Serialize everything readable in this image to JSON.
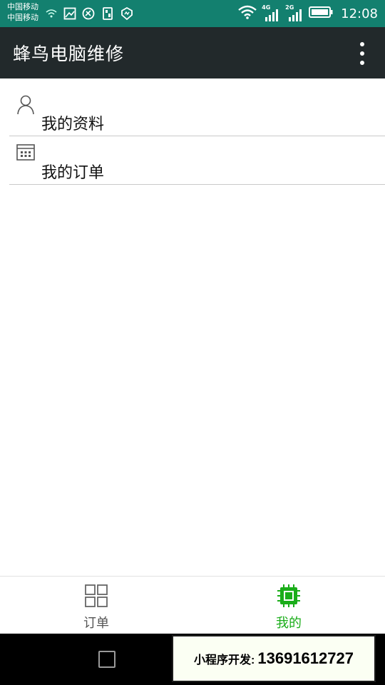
{
  "status_bar": {
    "carrier_1": "中国移动",
    "carrier_2": "中国移动",
    "network_1": "4G",
    "network_2": "2G",
    "time": "12:08",
    "icons": [
      "wifi-calling-icon",
      "image-icon",
      "vpn-icon",
      "sim-icon",
      "shield-icon",
      "wifi-icon",
      "signal-icon",
      "signal-icon",
      "battery-icon"
    ]
  },
  "app_bar": {
    "title": "蜂鸟电脑维修",
    "overflow_icon": "more-vert-icon"
  },
  "menu": {
    "items": [
      {
        "label": "我的资料",
        "icon": "person-icon"
      },
      {
        "label": "我的订单",
        "icon": "calendar-icon"
      }
    ]
  },
  "tab_bar": {
    "tabs": [
      {
        "label": "订单",
        "icon": "grid-icon",
        "active": false
      },
      {
        "label": "我的",
        "icon": "chip-icon",
        "active": true
      }
    ],
    "active_color": "#1aad19",
    "inactive_color": "#555555"
  },
  "nav_bar": {
    "recent_apps_icon": "square-icon"
  },
  "overlay": {
    "prefix": "小程序开发:",
    "phone": "13691612727"
  },
  "colors": {
    "status_bar": "#13806f",
    "app_bar": "#22292b"
  }
}
